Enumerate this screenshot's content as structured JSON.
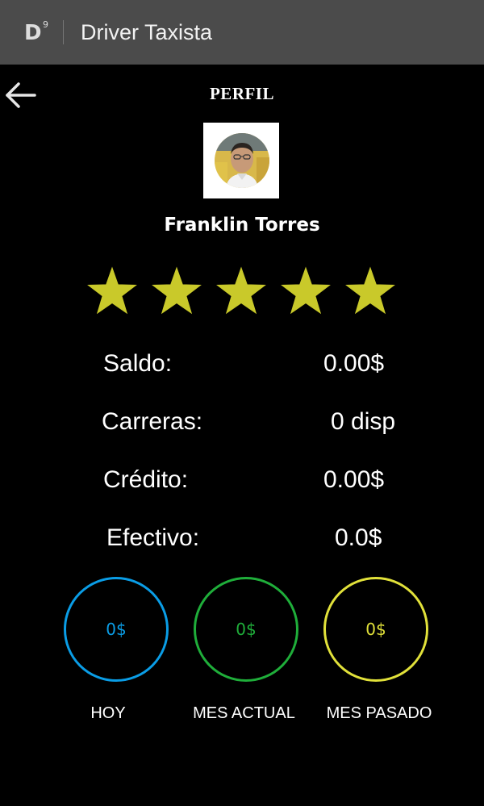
{
  "app_bar": {
    "logo_text": "D",
    "logo_sup": "9",
    "title": "Driver Taxista"
  },
  "header": {
    "back_icon": "arrow-left-icon",
    "title": "PERFIL"
  },
  "profile": {
    "photo_icon": "driver-photo",
    "name": "Franklin Torres",
    "rating": {
      "value": 5,
      "max": 5,
      "star_color": "#c9c92a"
    }
  },
  "stats": [
    {
      "label": "Saldo:",
      "value": "0.00$"
    },
    {
      "label": "Carreras:",
      "value": "0 disp"
    },
    {
      "label": "Crédito:",
      "value": "0.00$"
    },
    {
      "label": "Efectivo:",
      "value": "0.0$"
    }
  ],
  "earnings": [
    {
      "value": "0$",
      "caption": "HOY",
      "color": "#0a9de6"
    },
    {
      "value": "0$",
      "caption": "MES ACTUAL",
      "color": "#1fae3a"
    },
    {
      "value": "0$",
      "caption": "MES PASADO",
      "color": "#e1e13a"
    }
  ]
}
